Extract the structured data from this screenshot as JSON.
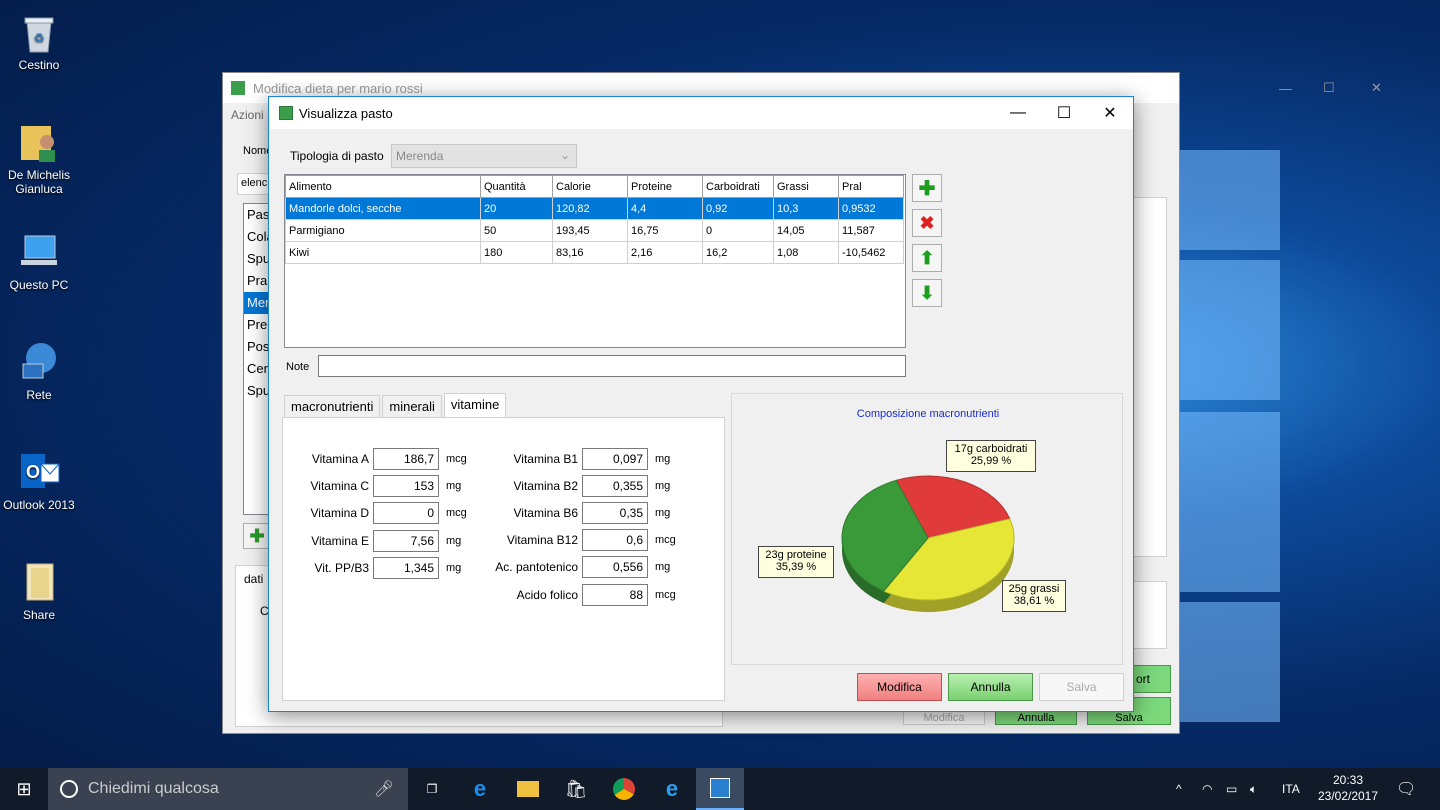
{
  "desktop": {
    "icons": [
      {
        "label": "Cestino",
        "name": "recycle-bin-icon"
      },
      {
        "label": "De Michelis Gianluca",
        "name": "user-folder-icon"
      },
      {
        "label": "Questo PC",
        "name": "this-pc-icon"
      },
      {
        "label": "Rete",
        "name": "network-icon"
      },
      {
        "label": "Outlook 2013",
        "name": "outlook-icon"
      },
      {
        "label": "Share",
        "name": "share-folder-icon"
      }
    ]
  },
  "bg_window": {
    "title": "Modifica dieta per mario rossi",
    "menu": "Azioni",
    "nome_label": "Nome",
    "elenco_label": "elenc",
    "list": [
      "Pas",
      "Cola",
      "Spu",
      "Pran",
      "Mer",
      "Pre-",
      "Pos",
      "Cen",
      "Spu"
    ],
    "dati_tab": "dati",
    "c_label": "C",
    "right_btn_1": "ort",
    "bottom_buttons": [
      "Modifica",
      "Annulla",
      "Salva"
    ]
  },
  "dialog": {
    "title": "Visualizza pasto",
    "tipologia_label": "Tipologia di pasto",
    "tipologia_value": "Merenda",
    "columns": [
      "Alimento",
      "Quantità",
      "Calorie",
      "Proteine",
      "Carboidrati",
      "Grassi",
      "Pral"
    ],
    "rows": [
      [
        "Mandorle dolci, secche",
        "20",
        "120,82",
        "4,4",
        "0,92",
        "10,3",
        "0,9532"
      ],
      [
        "Parmigiano",
        "50",
        "193,45",
        "16,75",
        "0",
        "14,05",
        "11,587"
      ],
      [
        "Kiwi",
        "180",
        "83,16",
        "2,16",
        "16,2",
        "1,08",
        "-10,5462"
      ]
    ],
    "note_label": "Note",
    "note_value": "",
    "tabs": [
      "macronutrienti",
      "minerali",
      "vitamine"
    ],
    "vit_left": [
      {
        "label": "Vitamina A",
        "value": "186,7",
        "unit": "mcg"
      },
      {
        "label": "Vitamina C",
        "value": "153",
        "unit": "mg"
      },
      {
        "label": "Vitamina D",
        "value": "0",
        "unit": "mcg"
      },
      {
        "label": "Vitamina E",
        "value": "7,56",
        "unit": "mg"
      },
      {
        "label": "Vit. PP/B3",
        "value": "1,345",
        "unit": "mg"
      }
    ],
    "vit_right": [
      {
        "label": "Vitamina B1",
        "value": "0,097",
        "unit": "mg"
      },
      {
        "label": "Vitamina B2",
        "value": "0,355",
        "unit": "mg"
      },
      {
        "label": "Vitamina B6",
        "value": "0,35",
        "unit": "mg"
      },
      {
        "label": "Vitamina B12",
        "value": "0,6",
        "unit": "mcg"
      },
      {
        "label": "Ac. pantotenico",
        "value": "0,556",
        "unit": "mg"
      },
      {
        "label": "Acido folico",
        "value": "88",
        "unit": "mcg"
      }
    ],
    "buttons": {
      "modifica": "Modifica",
      "annulla": "Annulla",
      "salva": "Salva"
    }
  },
  "chart_data": {
    "type": "pie",
    "title": "Composizione macronutrienti",
    "slices": [
      {
        "name": "carboidrati",
        "label_1": "17g carboidrati",
        "label_2": "25,99 %",
        "percent": 25.99,
        "color": "#e03a3a"
      },
      {
        "name": "grassi",
        "label_1": "25g grassi",
        "label_2": "38,61 %",
        "percent": 38.61,
        "color": "#e6e637"
      },
      {
        "name": "proteine",
        "label_1": "23g proteine",
        "label_2": "35,39 %",
        "percent": 35.39,
        "color": "#3a9a3a"
      }
    ]
  },
  "taskbar": {
    "search_placeholder": "Chiedimi qualcosa",
    "lang": "ITA",
    "time": "20:33",
    "date": "23/02/2017"
  }
}
